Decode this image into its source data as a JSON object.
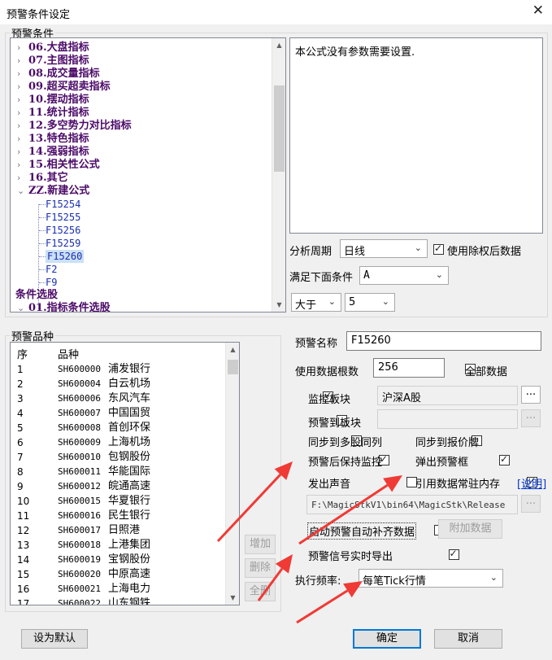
{
  "window": {
    "title": "预警条件设定",
    "close_glyph": "✕"
  },
  "conditions": {
    "group_label": "预警条件",
    "tree_categories": [
      "06.大盘指标",
      "07.主图指标",
      "08.成交量指标",
      "09.超买超卖指标",
      "10.摆动指标",
      "11.统计指标",
      "12.多空势力对比指标",
      "13.特色指标",
      "14.强弱指标",
      "15.相关性公式",
      "16.其它",
      "ZZ.新建公式"
    ],
    "tree_leaves": [
      "F15254",
      "F15255",
      "F15256",
      "F15259",
      "F15260",
      "F2",
      "F9"
    ],
    "selected_leaf_index": 4,
    "tree_section": "条件选股",
    "tree_last_item": "01.指标条件选股",
    "params_text": "本公式没有参数需要设置.",
    "period_label": "分析周期",
    "period_value": "日线",
    "adjusted_label": "使用除权后数据",
    "adjusted_checked": true,
    "condition_label": "满足下面条件",
    "condition_value": "A",
    "operator_value": "大于",
    "threshold_value": "5"
  },
  "stocks": {
    "group_label": "预警品种",
    "col_no": "序",
    "col_name": "品种",
    "rows": [
      {
        "no": "1",
        "code": "SH600000",
        "name": "浦发银行"
      },
      {
        "no": "2",
        "code": "SH600004",
        "name": "白云机场"
      },
      {
        "no": "3",
        "code": "SH600006",
        "name": "东风汽车"
      },
      {
        "no": "4",
        "code": "SH600007",
        "name": "中国国贸"
      },
      {
        "no": "5",
        "code": "SH600008",
        "name": "首创环保"
      },
      {
        "no": "6",
        "code": "SH600009",
        "name": "上海机场"
      },
      {
        "no": "7",
        "code": "SH600010",
        "name": "包钢股份"
      },
      {
        "no": "8",
        "code": "SH600011",
        "name": "华能国际"
      },
      {
        "no": "9",
        "code": "SH600012",
        "name": "皖通高速"
      },
      {
        "no": "10",
        "code": "SH600015",
        "name": "华夏银行"
      },
      {
        "no": "11",
        "code": "SH600016",
        "name": "民生银行"
      },
      {
        "no": "12",
        "code": "SH600017",
        "name": "日照港"
      },
      {
        "no": "13",
        "code": "SH600018",
        "name": "上港集团"
      },
      {
        "no": "14",
        "code": "SH600019",
        "name": "宝钢股份"
      },
      {
        "no": "15",
        "code": "SH600020",
        "name": "中原高速"
      },
      {
        "no": "16",
        "code": "SH600021",
        "name": "上海电力"
      },
      {
        "no": "17",
        "code": "SH600022",
        "name": "山东钢铁"
      }
    ],
    "add_label": "增加",
    "delete_label": "删除",
    "delete_all_label": "全删"
  },
  "settings": {
    "name_label": "预警名称",
    "name_value": "F15260",
    "bars_label": "使用数据根数",
    "bars_value": "256",
    "all_data_label": "全部数据",
    "monitor_board_label": "监控板块",
    "monitor_board_value": "沪深A股",
    "alert_to_board_label": "预警到板块",
    "browse_label": "...",
    "sync_multi_label": "同步到多股同列",
    "sync_quote_label": "同步到报价牌",
    "keep_monitor_label": "预警后保持监控",
    "popup_label": "弹出预警框",
    "sound_label": "发出声音",
    "ref_memory_label": "引用数据常驻内存",
    "explain_link": "[说明]",
    "path_value": "F:\\MagicStkV1\\bin64\\MagicStk\\Release",
    "auto_fill_label": "启动预警自动补齐数据",
    "extra_data_label": "附加数据",
    "realtime_export_label": "预警信号实时导出",
    "freq_label": "执行频率:",
    "freq_value": "每笔Tick行情"
  },
  "footer": {
    "set_default_label": "设为默认",
    "ok_label": "确定",
    "cancel_label": "取消"
  },
  "colors": {
    "annotation_arrow": "#f03a35",
    "accent": "#0078d7",
    "tree_text": "#4b0a68",
    "leaf_text": "#1a2fb0"
  }
}
